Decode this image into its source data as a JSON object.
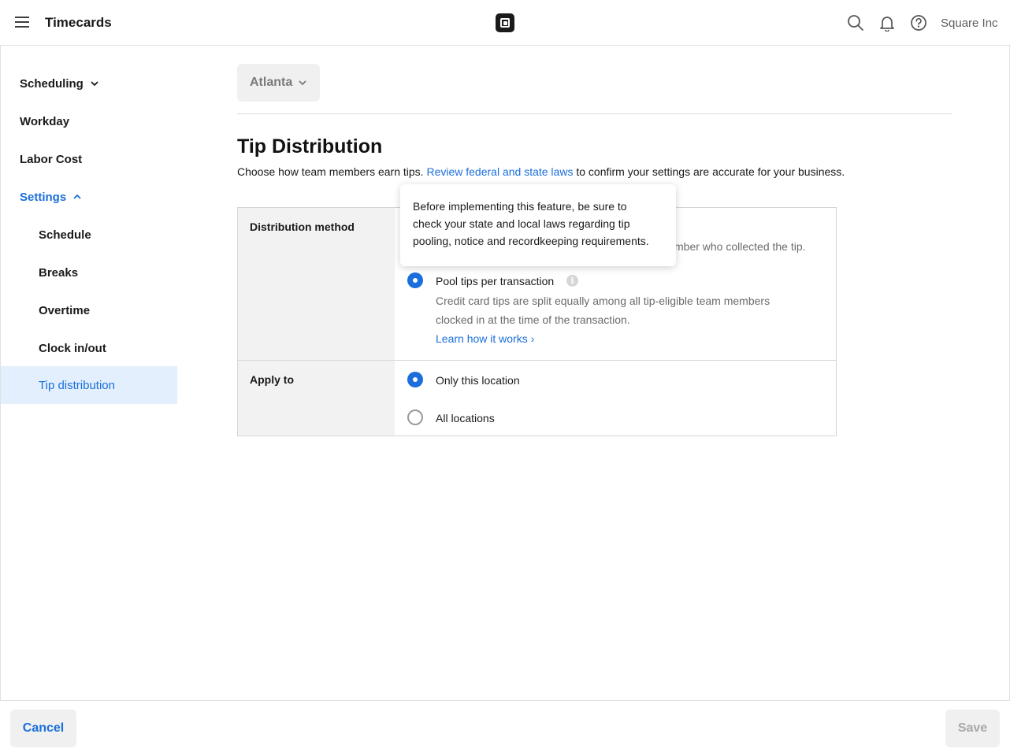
{
  "header": {
    "app_title": "Timecards",
    "account_name": "Square Inc",
    "icons": [
      "menu-icon",
      "square-logo",
      "search-icon",
      "bell-icon",
      "help-icon"
    ]
  },
  "sidebar": {
    "items": [
      {
        "label": "Scheduling",
        "expanded": false
      },
      {
        "label": "Workday"
      },
      {
        "label": "Labor Cost"
      },
      {
        "label": "Settings",
        "expanded": true
      },
      {
        "label": "Schedule"
      },
      {
        "label": "Breaks"
      },
      {
        "label": "Overtime"
      },
      {
        "label": "Clock in/out"
      },
      {
        "label": "Tip distribution",
        "active": true
      }
    ]
  },
  "location": {
    "selected": "Atlanta"
  },
  "main": {
    "title": "Tip Distribution",
    "desc_before": "Choose how team members earn tips. ",
    "desc_link": "Review federal and state laws",
    "desc_after": " to confirm your settings are accurate for your business.",
    "distribution": {
      "label": "Distribution method",
      "hidden_option_desc": "mber who collected the tip.",
      "pool_option": {
        "label": "Pool tips per transaction",
        "desc_line1": "Credit card tips are split equally among all tip-eligible team members",
        "desc_line2": "clocked in at the time of the transaction.",
        "learn_link": "Learn how it works ›",
        "selected": true
      }
    },
    "apply_to": {
      "label": "Apply to",
      "options": [
        {
          "label": "Only this location",
          "selected": true
        },
        {
          "label": "All locations",
          "selected": false
        }
      ]
    },
    "tooltip": {
      "line1": "Before implementing this feature, be sure to",
      "line2": "check your state and local laws regarding tip",
      "line3": "pooling, notice and recordkeeping requirements."
    }
  },
  "footer": {
    "cancel_label": "Cancel",
    "save_label": "Save",
    "save_disabled": true
  },
  "colors": {
    "accent": "#1a6fdc",
    "active_bg": "#e3effd",
    "label_bg": "#f2f2f2"
  }
}
